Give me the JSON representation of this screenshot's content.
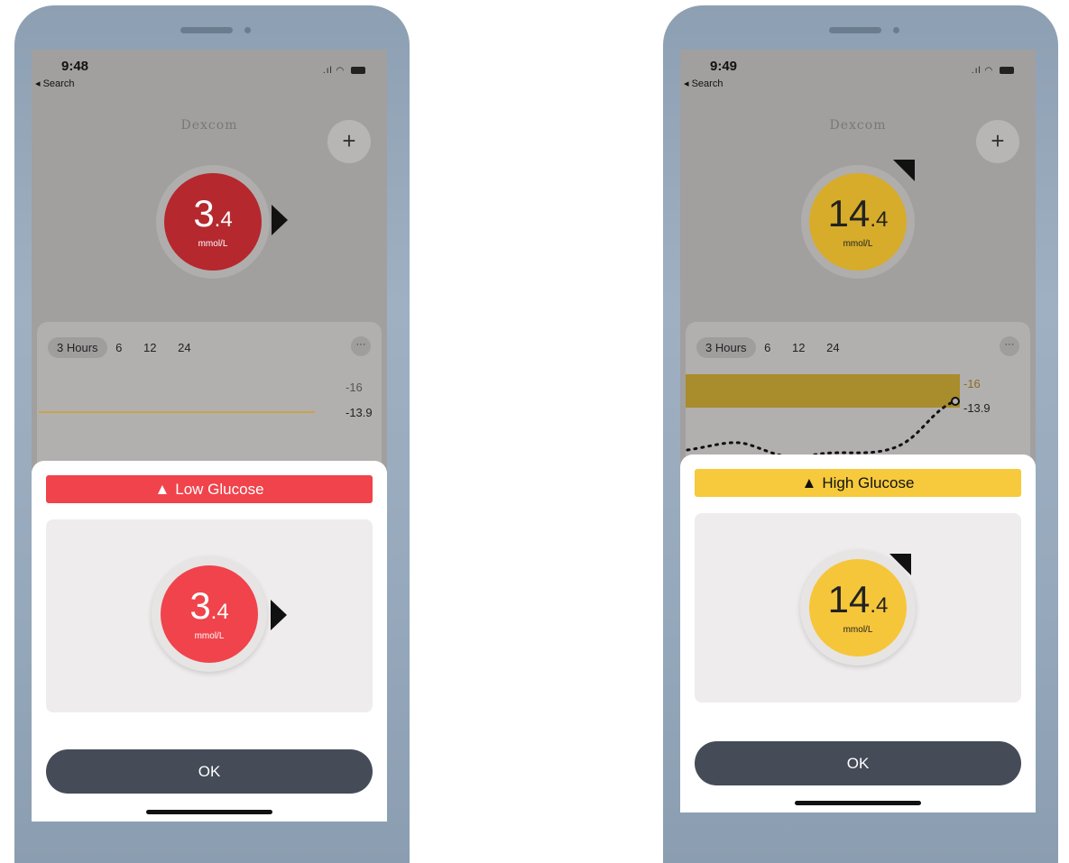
{
  "left_phone": {
    "time": "9:48",
    "back": "◂ Search",
    "brand": "Dexcom",
    "plus": "+",
    "reading": {
      "main": "3",
      "decimal": ".4",
      "unit": "mmol/L",
      "color": "#e0333b",
      "trend_icon": "trend-arrow-right-icon"
    },
    "range_tabs": [
      "3 Hours",
      "6",
      "12",
      "24"
    ],
    "more": "···",
    "y_labels": [
      "-16",
      "-13.9"
    ],
    "alert": {
      "title": "Low Glucose",
      "color": "#f0434b",
      "icon": "warning-triangle-icon"
    },
    "alert_reading": {
      "main": "3",
      "decimal": ".4",
      "unit": "mmol/L",
      "color": "#f0434b"
    },
    "ok_label": "OK"
  },
  "right_phone": {
    "time": "9:49",
    "back": "◂ Search",
    "brand": "Dexcom",
    "plus": "+",
    "reading": {
      "main": "14",
      "decimal": ".4",
      "unit": "mmol/L",
      "color": "#d6ac2a",
      "trend_icon": "trend-arrow-up-right-icon"
    },
    "range_tabs": [
      "3 Hours",
      "6",
      "12",
      "24"
    ],
    "more": "···",
    "y_labels": [
      "-16",
      "-13.9"
    ],
    "alert": {
      "title": "High Glucose",
      "color": "#f6ca3c",
      "icon": "warning-triangle-icon"
    },
    "alert_reading": {
      "main": "14",
      "decimal": ".4",
      "unit": "mmol/L",
      "color": "#f6c63a"
    },
    "ok_label": "OK"
  }
}
